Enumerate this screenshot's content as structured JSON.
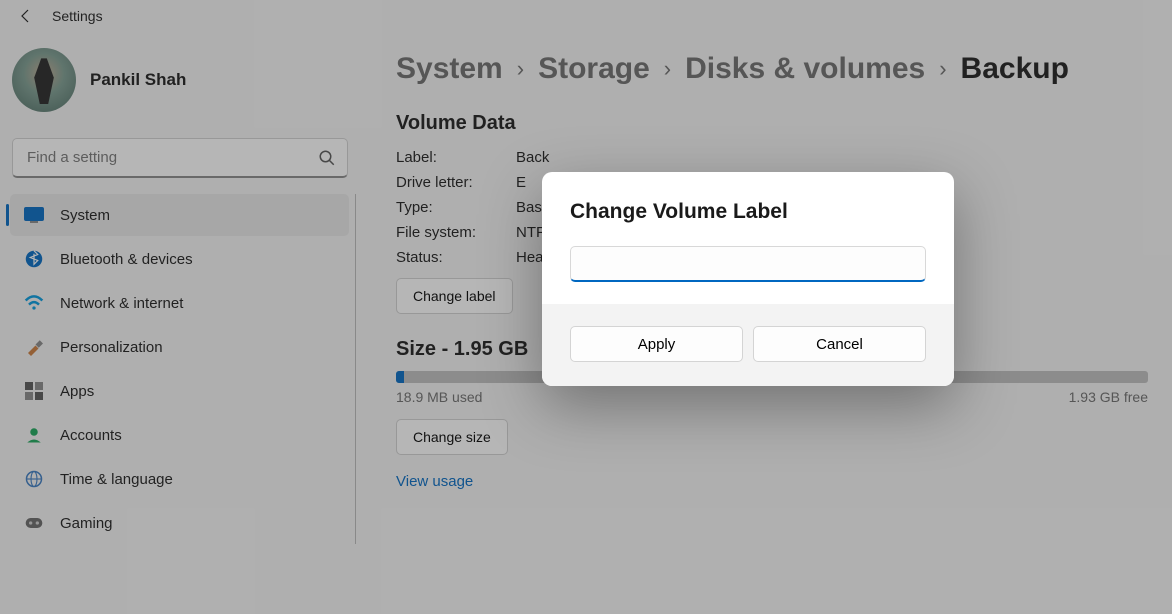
{
  "titlebar": {
    "title": "Settings"
  },
  "profile": {
    "name": "Pankil Shah"
  },
  "search": {
    "placeholder": "Find a setting"
  },
  "sidebar": {
    "items": [
      {
        "label": "System",
        "icon": "system-icon",
        "selected": true
      },
      {
        "label": "Bluetooth & devices",
        "icon": "bluetooth-icon"
      },
      {
        "label": "Network & internet",
        "icon": "wifi-icon"
      },
      {
        "label": "Personalization",
        "icon": "brush-icon"
      },
      {
        "label": "Apps",
        "icon": "apps-icon"
      },
      {
        "label": "Accounts",
        "icon": "person-icon"
      },
      {
        "label": "Time & language",
        "icon": "globe-icon"
      },
      {
        "label": "Gaming",
        "icon": "gamepad-icon"
      }
    ]
  },
  "breadcrumb": {
    "items": [
      "System",
      "Storage",
      "Disks & volumes",
      "Backup"
    ]
  },
  "volume": {
    "section_title": "Volume Data",
    "rows": {
      "label_k": "Label:",
      "label_v": "Back",
      "drive_k": "Drive letter:",
      "drive_v": "E",
      "type_k": "Type:",
      "type_v": "Basi",
      "fs_k": "File system:",
      "fs_v": "NTF",
      "status_k": "Status:",
      "status_v": "Hea"
    },
    "change_label_btn": "Change label"
  },
  "size": {
    "title": "Size - 1.95 GB",
    "used": "18.9 MB used",
    "free": "1.93 GB free",
    "change_size_btn": "Change size",
    "view_usage": "View usage"
  },
  "dialog": {
    "title": "Change Volume Label",
    "input_value": "",
    "apply": "Apply",
    "cancel": "Cancel"
  }
}
